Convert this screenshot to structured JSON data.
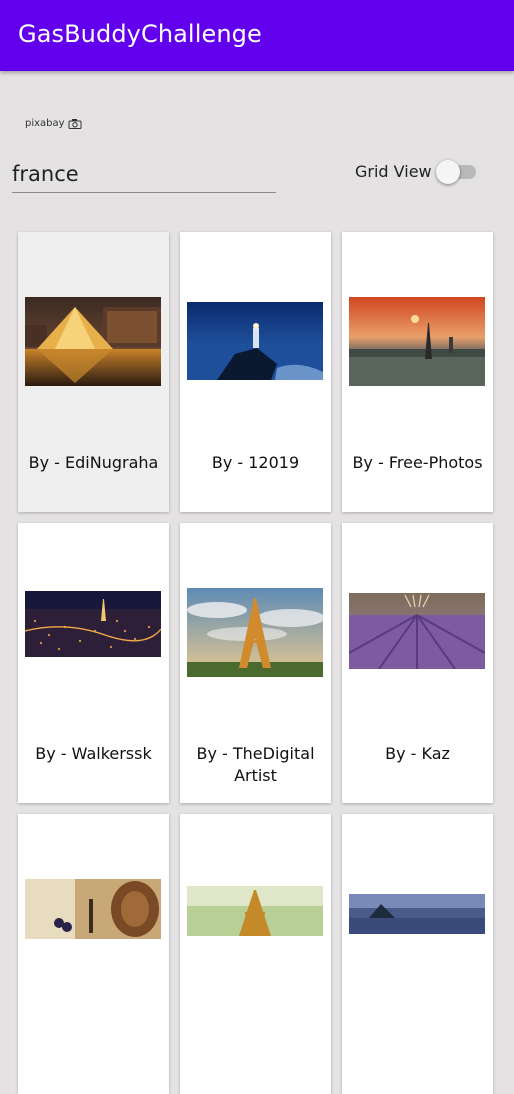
{
  "app": {
    "title": "GasBuddyChallenge"
  },
  "logo": {
    "text": "pixabay"
  },
  "search": {
    "value": "france"
  },
  "grid_toggle": {
    "label": "Grid View",
    "checked": false
  },
  "cards": [
    {
      "caption": "By - EdiNugraha"
    },
    {
      "caption": "By - 12019"
    },
    {
      "caption": "By - Free-Photos"
    },
    {
      "caption": "By - Walkerssk"
    },
    {
      "caption": "By - TheDigital Artist"
    },
    {
      "caption": "By - Kaz"
    },
    {
      "caption": ""
    },
    {
      "caption": ""
    },
    {
      "caption": ""
    }
  ]
}
